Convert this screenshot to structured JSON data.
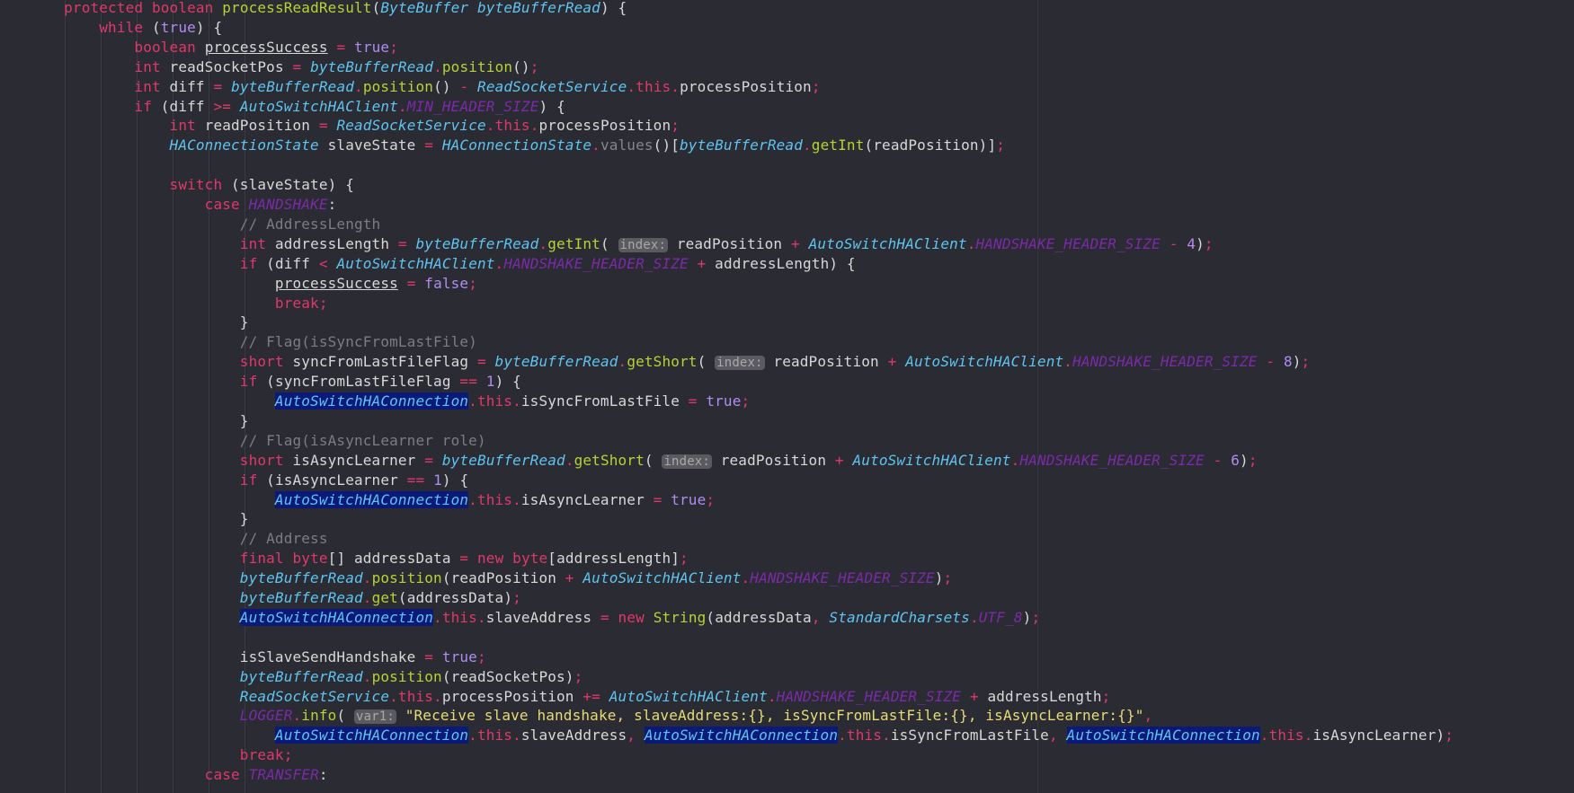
{
  "code_lines": [
    "    protected boolean processReadResult(ByteBuffer byteBufferRead) {",
    "        while (true) {",
    "            boolean processSuccess = true;",
    "            int readSocketPos = byteBufferRead.position();",
    "            int diff = byteBufferRead.position() - ReadSocketService.this.processPosition;",
    "            if (diff >= AutoSwitchHAClient.MIN_HEADER_SIZE) {",
    "                int readPosition = ReadSocketService.this.processPosition;",
    "                HAConnectionState slaveState = HAConnectionState.values()[byteBufferRead.getInt(readPosition)];",
    "",
    "                switch (slaveState) {",
    "                    case HANDSHAKE:",
    "                        // AddressLength",
    "                        int addressLength = byteBufferRead.getInt( index: readPosition + AutoSwitchHAClient.HANDSHAKE_HEADER_SIZE - 4);",
    "                        if (diff < AutoSwitchHAClient.HANDSHAKE_HEADER_SIZE + addressLength) {",
    "                            processSuccess = false;",
    "                            break;",
    "                        }",
    "                        // Flag(isSyncFromLastFile)",
    "                        short syncFromLastFileFlag = byteBufferRead.getShort( index: readPosition + AutoSwitchHAClient.HANDSHAKE_HEADER_SIZE - 8);",
    "                        if (syncFromLastFileFlag == 1) {",
    "                            AutoSwitchHAConnection.this.isSyncFromLastFile = true;",
    "                        }",
    "                        // Flag(isAsyncLearner role)",
    "                        short isAsyncLearner = byteBufferRead.getShort( index: readPosition + AutoSwitchHAClient.HANDSHAKE_HEADER_SIZE - 6);",
    "                        if (isAsyncLearner == 1) {",
    "                            AutoSwitchHAConnection.this.isAsyncLearner = true;",
    "                        }",
    "                        // Address",
    "                        final byte[] addressData = new byte[addressLength];",
    "                        byteBufferRead.position(readPosition + AutoSwitchHAClient.HANDSHAKE_HEADER_SIZE);",
    "                        byteBufferRead.get(addressData);",
    "                        AutoSwitchHAConnection.this.slaveAddress = new String(addressData, StandardCharsets.UTF_8);",
    "",
    "                        isSlaveSendHandshake = true;",
    "                        byteBufferRead.position(readSocketPos);",
    "                        ReadSocketService.this.processPosition += AutoSwitchHAClient.HANDSHAKE_HEADER_SIZE + addressLength;",
    "                        LOGGER.info( var1: \"Receive slave handshake, slaveAddress:{}, isSyncFromLastFile:{}, isAsyncLearner:{}\",",
    "                            AutoSwitchHAConnection.this.slaveAddress, AutoSwitchHAConnection.this.isSyncFromLastFile, AutoSwitchHAConnection.this.isAsyncLearner);",
    "                        break;",
    "                    case TRANSFER:"
  ],
  "inlay_hints": {
    "index": "index:",
    "var1": "var1:"
  },
  "colors": {
    "background": "#2b2b33",
    "keyword": "#e0386b",
    "method": "#b5d334",
    "class": "#5ec4f0",
    "constant": "#7b2aa8",
    "number": "#b08cf0",
    "string": "#e6db74",
    "comment": "#7c7c82",
    "highlight": "#0b1a78"
  }
}
